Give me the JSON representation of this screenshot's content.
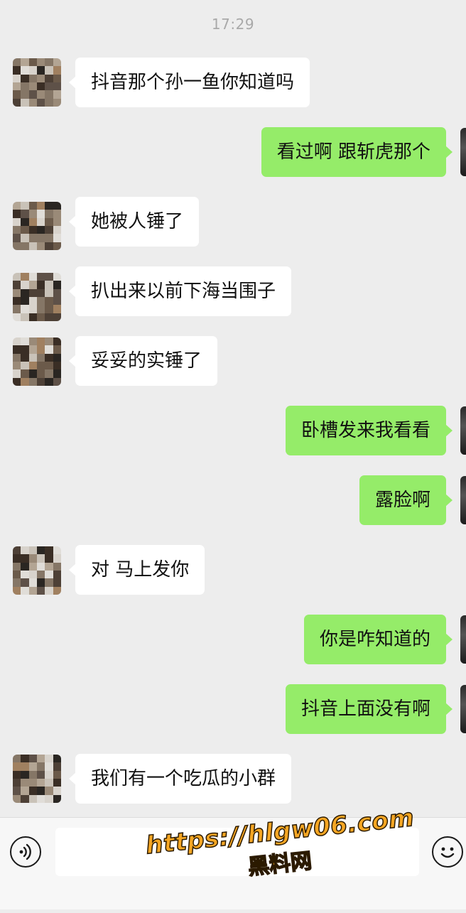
{
  "timestamp": "17:29",
  "messages": [
    {
      "side": "in",
      "text": "抖音那个孙一鱼你知道吗"
    },
    {
      "side": "out",
      "text": "看过啊 跟斩虎那个"
    },
    {
      "side": "in",
      "text": "她被人锤了"
    },
    {
      "side": "in",
      "text": "扒出来以前下海当围子"
    },
    {
      "side": "in",
      "text": "妥妥的实锤了"
    },
    {
      "side": "out",
      "text": "卧槽发来我看看"
    },
    {
      "side": "out",
      "text": "露脸啊"
    },
    {
      "side": "in",
      "text": "对 马上发你"
    },
    {
      "side": "out",
      "text": "你是咋知道的"
    },
    {
      "side": "out",
      "text": "抖音上面没有啊"
    },
    {
      "side": "in",
      "text": "我们有一个吃瓜的小群"
    }
  ],
  "input_bar": {
    "voice_icon": "voice-icon",
    "emoji_icon": "emoji-icon",
    "text_value": ""
  },
  "watermark": {
    "url": "https://hlgw06.com",
    "name": "黑料网"
  },
  "colors": {
    "background": "#ededed",
    "incoming_bubble": "#ffffff",
    "outgoing_bubble": "#95ec69",
    "watermark": "#f5a623"
  }
}
